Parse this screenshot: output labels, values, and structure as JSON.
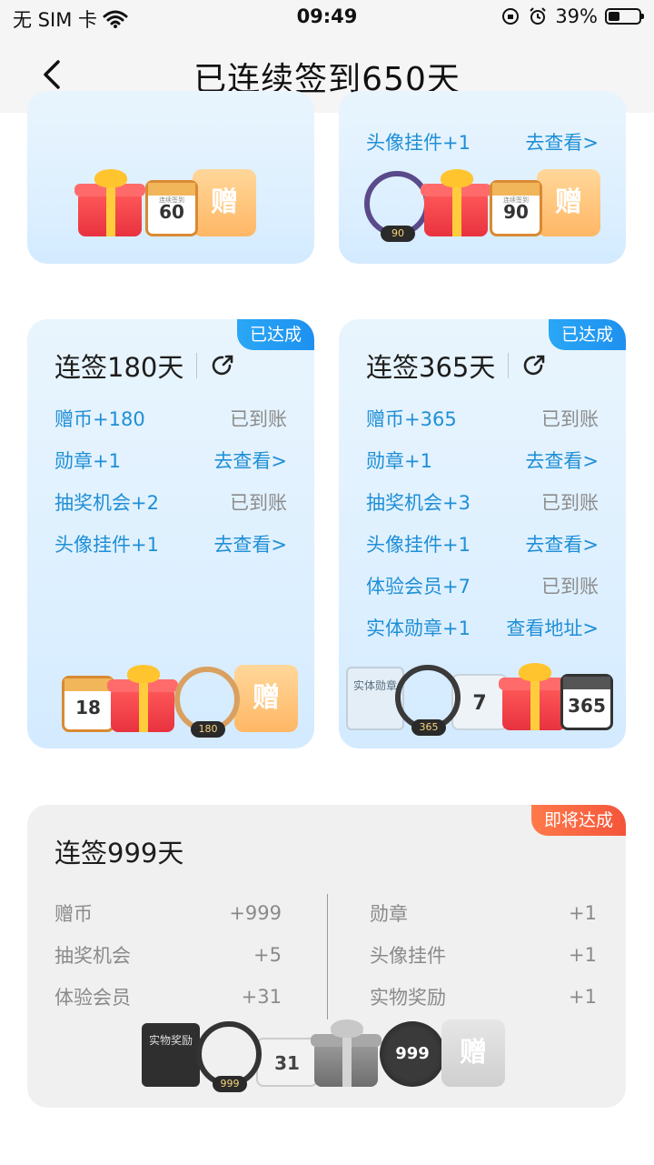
{
  "status_bar": {
    "carrier": "无 SIM 卡",
    "time": "09:49",
    "battery": "39%",
    "battery_level": 0.39
  },
  "nav": {
    "title": "已连续签到650天"
  },
  "card_60": {
    "calendar_label": "连续签到",
    "calendar_number": "60",
    "coupon_char": "赠"
  },
  "card_90": {
    "rows": [
      {
        "label": "头像挂件+1",
        "action": "去查看>"
      }
    ],
    "ring_tag": "90",
    "calendar_label": "连续签到",
    "calendar_number": "90",
    "coupon_char": "赠"
  },
  "card_180": {
    "badge": "已达成",
    "title": "连签180天",
    "rows": [
      {
        "label": "赠币+180",
        "action": "已到账"
      },
      {
        "label": "勋章+1",
        "action": "去查看>"
      },
      {
        "label": "抽奖机会+2",
        "action": "已到账"
      },
      {
        "label": "头像挂件+1",
        "action": "去查看>"
      }
    ],
    "calendar_number": "18",
    "ring_tag": "180",
    "coupon_char": "赠"
  },
  "card_365": {
    "badge": "已达成",
    "title": "连签365天",
    "rows": [
      {
        "label": "赠币+365",
        "action": "已到账"
      },
      {
        "label": "勋章+1",
        "action": "去查看>"
      },
      {
        "label": "抽奖机会+3",
        "action": "已到账"
      },
      {
        "label": "头像挂件+1",
        "action": "去查看>"
      },
      {
        "label": "体验会员+7",
        "action": "已到账"
      },
      {
        "label": "实体勋章+1",
        "action": "查看地址>"
      }
    ],
    "book_text": "实体勋章",
    "ring_tag": "365",
    "member_days": "7",
    "calendar_number": "365",
    "coupon_char": "赠"
  },
  "card_999": {
    "badge": "即将达成",
    "title": "连签999天",
    "left": [
      {
        "label": "赠币",
        "value": "+999"
      },
      {
        "label": "抽奖机会",
        "value": "+5"
      },
      {
        "label": "体验会员",
        "value": "+31"
      }
    ],
    "right": [
      {
        "label": "勋章",
        "value": "+1"
      },
      {
        "label": "头像挂件",
        "value": "+1"
      },
      {
        "label": "实物奖励",
        "value": "+1"
      }
    ],
    "book_text": "实物奖励",
    "ring_tag": "999",
    "ticket_number": "31",
    "coin_number": "999",
    "coupon_char": "赠"
  }
}
